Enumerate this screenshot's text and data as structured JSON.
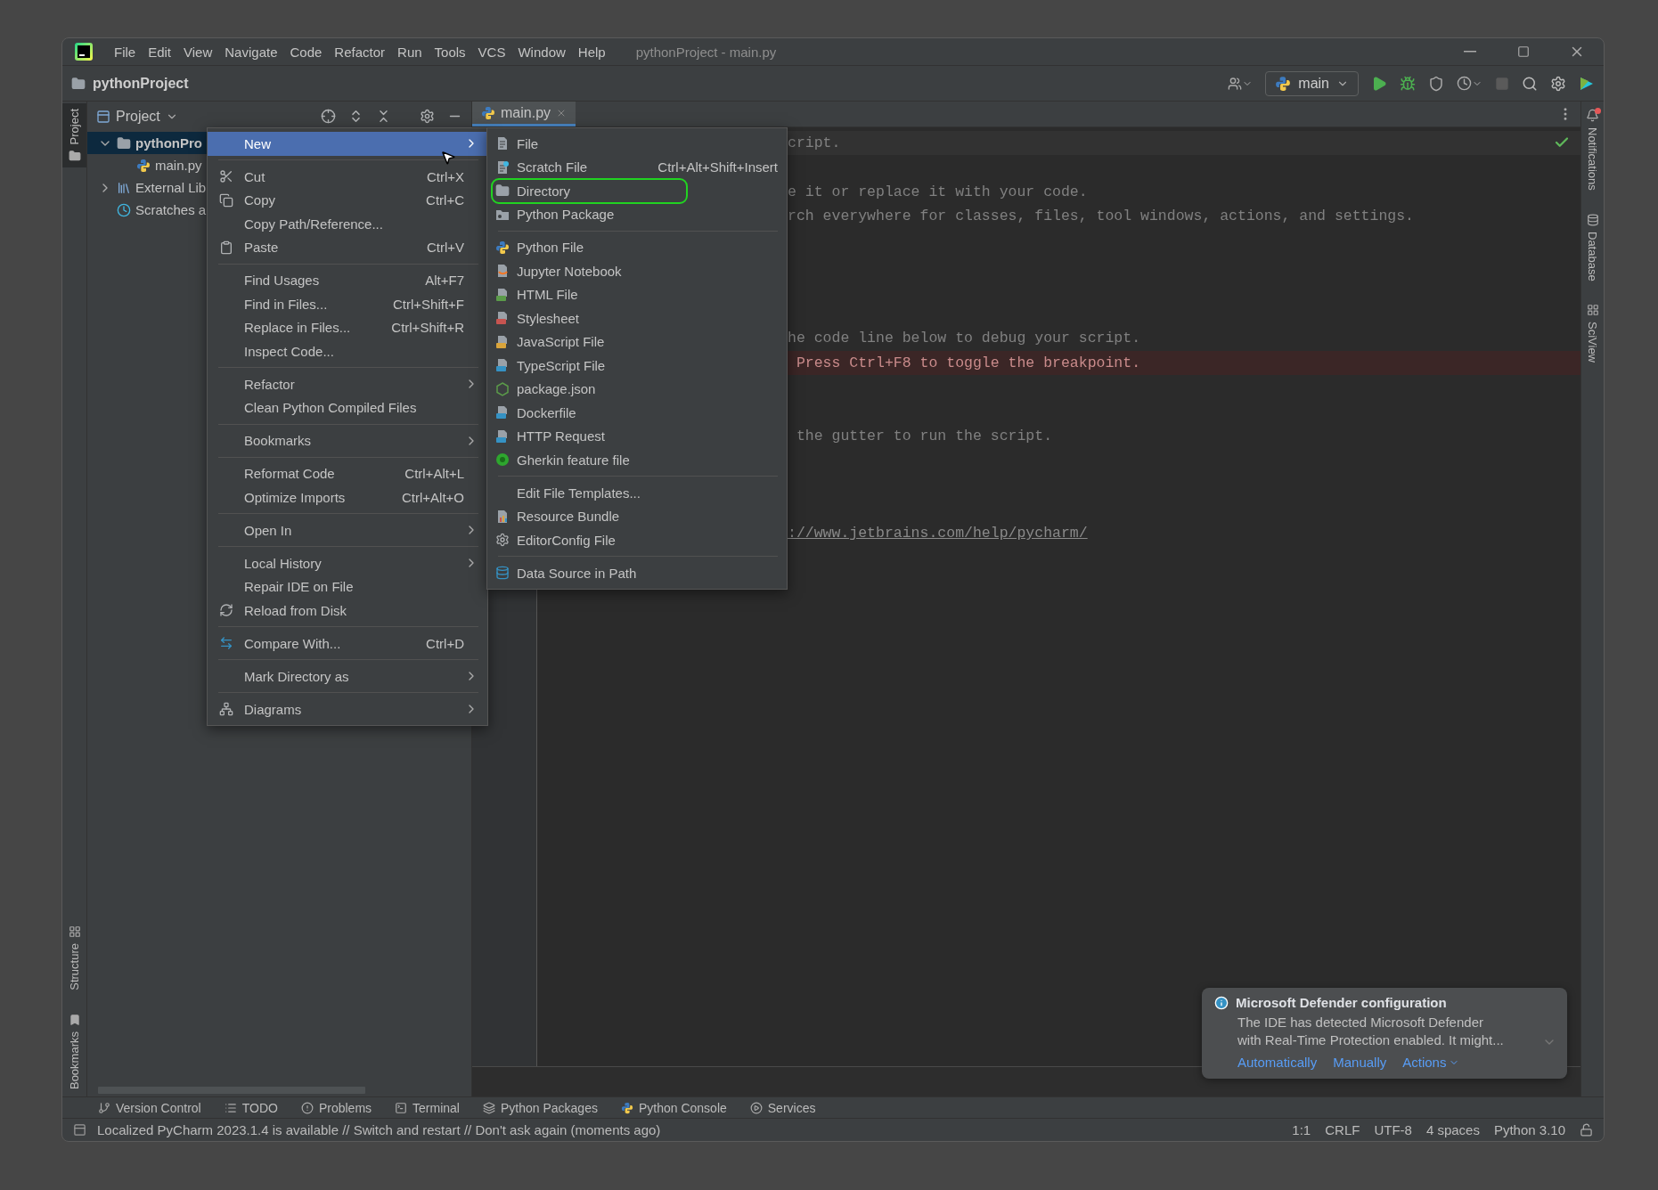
{
  "window": {
    "title": "pythonProject - main.py"
  },
  "menu_bar": [
    "File",
    "Edit",
    "View",
    "Navigate",
    "Code",
    "Refactor",
    "Run",
    "Tools",
    "VCS",
    "Window",
    "Help"
  ],
  "navigation": {
    "project": "pythonProject"
  },
  "run_config": {
    "label": "main"
  },
  "left_stripe": {
    "top": [
      {
        "label": "Project",
        "selected": true
      }
    ],
    "bottom": [
      {
        "label": "Structure",
        "selected": false
      },
      {
        "label": "Bookmarks",
        "selected": false
      }
    ]
  },
  "right_stripe": [
    {
      "label": "Notifications",
      "kind": "bell"
    },
    {
      "label": "Database",
      "kind": "database"
    },
    {
      "label": "SciView",
      "kind": "grid"
    }
  ],
  "project_panel": {
    "title": "Project",
    "tree": [
      {
        "label": "pythonPro",
        "kind": "folder",
        "selected": true,
        "expanded": true,
        "children": [
          {
            "label": "main.py",
            "kind": "python",
            "selected": false
          }
        ]
      },
      {
        "label": "External Lib",
        "kind": "library",
        "selected": false,
        "expanded": false
      },
      {
        "label": "Scratches a",
        "kind": "scratches",
        "selected": false
      }
    ]
  },
  "editor": {
    "tab": {
      "label": "main.py",
      "selected": true
    },
    "lines": [
      {
        "kind": "comment",
        "text": "cript.",
        "current": true
      },
      {
        "kind": "blank",
        "current": false
      },
      {
        "kind": "comment",
        "text": "e it or replace it with your code.",
        "current": false
      },
      {
        "kind": "comment",
        "text": "rch everywhere for classes, files, tool windows, actions, and settings.",
        "current": false
      },
      {
        "kind": "blank",
        "current": false
      },
      {
        "kind": "blank",
        "current": false
      },
      {
        "kind": "blank",
        "current": false
      },
      {
        "kind": "blank",
        "current": false
      },
      {
        "kind": "comment",
        "text": "he code line below to debug your script.",
        "current": false
      },
      {
        "kind": "breakpoint",
        "text": " Press Ctrl+F8 to toggle the breakpoint.",
        "current": false
      },
      {
        "kind": "blank",
        "current": false
      },
      {
        "kind": "blank",
        "current": false
      },
      {
        "kind": "comment",
        "text": " the gutter to run the script.",
        "current": false
      },
      {
        "kind": "blank",
        "current": false
      },
      {
        "kind": "blank",
        "current": false
      },
      {
        "kind": "blank",
        "current": false
      },
      {
        "kind": "link",
        "text": "://www.jetbrains.com/help/pycharm/",
        "current": false
      }
    ]
  },
  "context_menu": {
    "groups": [
      {
        "items": [
          {
            "label": "New",
            "kind": "plain",
            "submenu": true,
            "selected": true
          }
        ]
      },
      {
        "items": [
          {
            "label": "Cut",
            "shortcut": "Ctrl+X",
            "kind": "cut",
            "submenu": false,
            "selected": false
          },
          {
            "label": "Copy",
            "shortcut": "Ctrl+C",
            "kind": "copy",
            "submenu": false,
            "selected": false
          },
          {
            "label": "Copy Path/Reference...",
            "kind": "plain",
            "submenu": false,
            "selected": false
          },
          {
            "label": "Paste",
            "shortcut": "Ctrl+V",
            "kind": "paste",
            "submenu": false,
            "selected": false
          }
        ]
      },
      {
        "items": [
          {
            "label": "Find Usages",
            "shortcut": "Alt+F7",
            "kind": "plain",
            "submenu": false,
            "selected": false
          },
          {
            "label": "Find in Files...",
            "shortcut": "Ctrl+Shift+F",
            "kind": "plain",
            "submenu": false,
            "selected": false
          },
          {
            "label": "Replace in Files...",
            "shortcut": "Ctrl+Shift+R",
            "kind": "plain",
            "submenu": false,
            "selected": false
          },
          {
            "label": "Inspect Code...",
            "kind": "plain",
            "submenu": false,
            "selected": false
          }
        ]
      },
      {
        "items": [
          {
            "label": "Refactor",
            "kind": "plain",
            "submenu": true,
            "selected": false
          },
          {
            "label": "Clean Python Compiled Files",
            "kind": "plain",
            "submenu": false,
            "selected": false
          }
        ]
      },
      {
        "items": [
          {
            "label": "Bookmarks",
            "kind": "plain",
            "submenu": true,
            "selected": false
          }
        ]
      },
      {
        "items": [
          {
            "label": "Reformat Code",
            "shortcut": "Ctrl+Alt+L",
            "kind": "plain",
            "submenu": false,
            "selected": false
          },
          {
            "label": "Optimize Imports",
            "shortcut": "Ctrl+Alt+O",
            "kind": "plain",
            "submenu": false,
            "selected": false
          }
        ]
      },
      {
        "items": [
          {
            "label": "Open In",
            "kind": "plain",
            "submenu": true,
            "selected": false
          }
        ]
      },
      {
        "items": [
          {
            "label": "Local History",
            "kind": "plain",
            "submenu": true,
            "selected": false
          },
          {
            "label": "Repair IDE on File",
            "kind": "plain",
            "submenu": false,
            "selected": false
          },
          {
            "label": "Reload from Disk",
            "kind": "reload",
            "submenu": false,
            "selected": false
          }
        ]
      },
      {
        "items": [
          {
            "label": "Compare With...",
            "shortcut": "Ctrl+D",
            "kind": "compare",
            "submenu": false,
            "selected": false
          }
        ]
      },
      {
        "items": [
          {
            "label": "Mark Directory as",
            "kind": "plain",
            "submenu": true,
            "selected": false
          }
        ]
      },
      {
        "items": [
          {
            "label": "Diagrams",
            "kind": "diagrams",
            "submenu": true,
            "selected": false
          }
        ]
      }
    ]
  },
  "submenu": {
    "groups": [
      {
        "items": [
          {
            "label": "File",
            "kind": "file",
            "outlined": false
          },
          {
            "label": "Scratch File",
            "shortcut": "Ctrl+Alt+Shift+Insert",
            "kind": "scratch",
            "outlined": false
          },
          {
            "label": "Directory",
            "kind": "folder",
            "outlined": true
          },
          {
            "label": "Python Package",
            "kind": "package",
            "outlined": false
          }
        ]
      },
      {
        "items": [
          {
            "label": "Python File",
            "kind": "python",
            "outlined": false
          },
          {
            "label": "Jupyter Notebook",
            "kind": "jupyter",
            "outlined": false
          },
          {
            "label": "HTML File",
            "kind": "html",
            "outlined": false
          },
          {
            "label": "Stylesheet",
            "kind": "css",
            "outlined": false
          },
          {
            "label": "JavaScript File",
            "kind": "js",
            "outlined": false
          },
          {
            "label": "TypeScript File",
            "kind": "ts",
            "outlined": false
          },
          {
            "label": "package.json",
            "kind": "node",
            "outlined": false
          },
          {
            "label": "Dockerfile",
            "kind": "docker",
            "outlined": false
          },
          {
            "label": "HTTP Request",
            "kind": "http",
            "outlined": false
          },
          {
            "label": "Gherkin feature file",
            "kind": "gherkin",
            "outlined": false
          }
        ]
      },
      {
        "items": [
          {
            "label": "Edit File Templates...",
            "kind": "plain",
            "outlined": false
          },
          {
            "label": "Resource Bundle",
            "kind": "bundle",
            "outlined": false
          },
          {
            "label": "EditorConfig File",
            "kind": "gear",
            "outlined": false
          }
        ]
      },
      {
        "items": [
          {
            "label": "Data Source in Path",
            "kind": "database",
            "outlined": false
          }
        ]
      }
    ]
  },
  "notification": {
    "title": "Microsoft Defender configuration",
    "body_lines": [
      "The IDE has detected Microsoft Defender",
      "with Real-Time Protection enabled. It might..."
    ],
    "actions": [
      {
        "label": "Automatically",
        "dropdown": false
      },
      {
        "label": "Manually",
        "dropdown": false
      },
      {
        "label": "Actions",
        "dropdown": true
      }
    ]
  },
  "tool_strip": [
    {
      "label": "Version Control",
      "kind": "branch"
    },
    {
      "label": "TODO",
      "kind": "list"
    },
    {
      "label": "Problems",
      "kind": "problems"
    },
    {
      "label": "Terminal",
      "kind": "terminal"
    },
    {
      "label": "Python Packages",
      "kind": "layers"
    },
    {
      "label": "Python Console",
      "kind": "python"
    },
    {
      "label": "Services",
      "kind": "services"
    }
  ],
  "status_bar": {
    "message": "Localized PyCharm 2023.1.4 is available // Switch and restart // Don't ask again (moments ago)",
    "items": [
      "1:1",
      "CRLF",
      "UTF-8",
      "4 spaces",
      "Python 3.10"
    ]
  }
}
